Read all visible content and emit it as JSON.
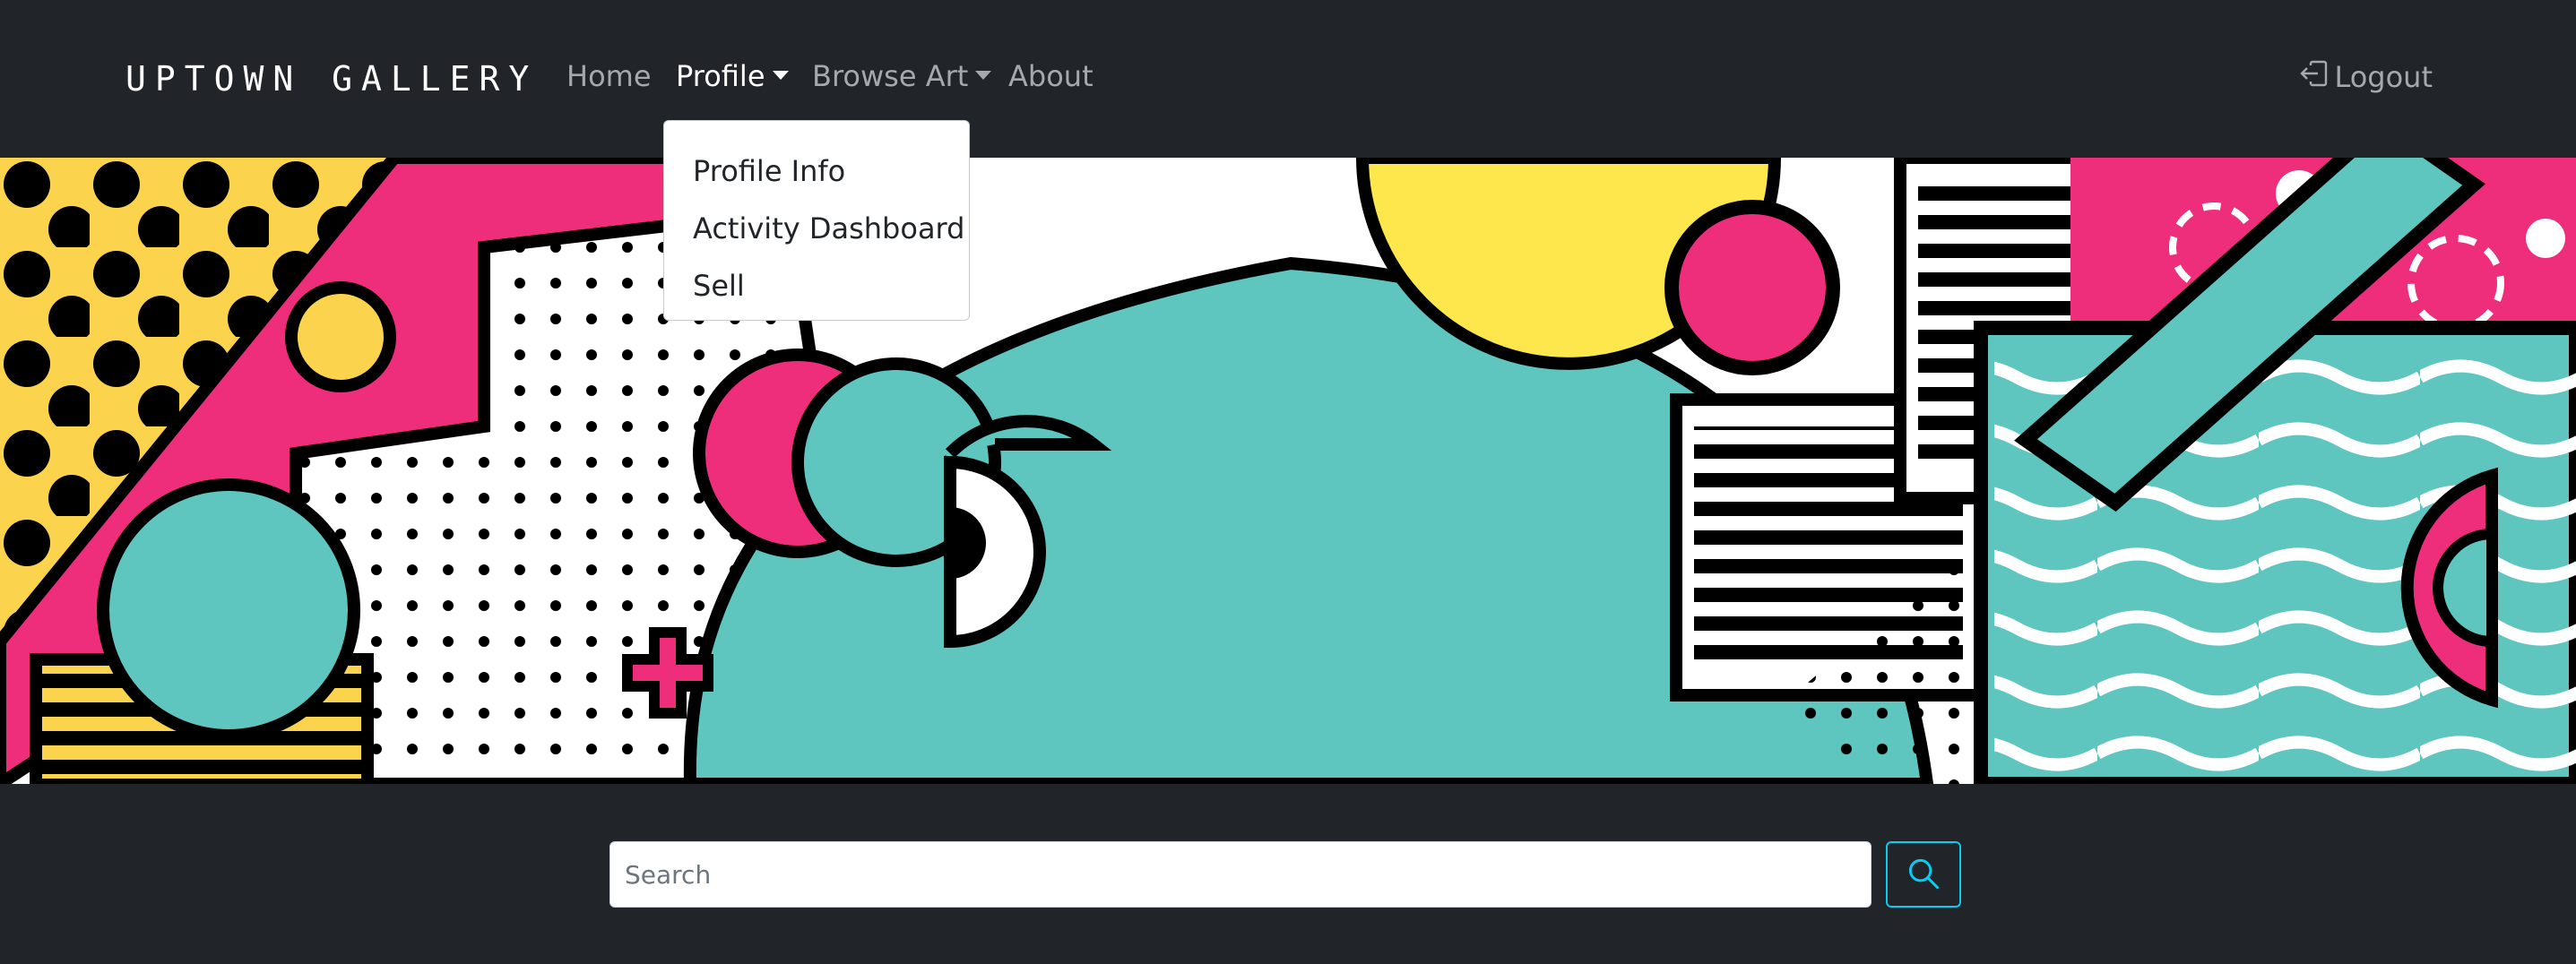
{
  "brand": {
    "name": "UPTOWN GALLERY"
  },
  "nav": {
    "home": "Home",
    "profile": "Profile",
    "browse_art": "Browse Art",
    "about": "About",
    "logout": "Logout"
  },
  "profile_menu": {
    "items": [
      "Profile Info",
      "Activity Dashboard",
      "Sell"
    ]
  },
  "search": {
    "placeholder": "Search"
  },
  "colors": {
    "navbar_bg": "#212529",
    "nav_text": "#a5a9ad",
    "nav_active": "#ffffff",
    "banner_pink": "#ee2e7b",
    "banner_yellow": "#fcd34d",
    "banner_teal": "#5ec6bf",
    "search_button_border": "#0dcaf0"
  },
  "icons": {
    "logout": "box-arrow-in-left-icon",
    "search": "magnifier-icon"
  }
}
